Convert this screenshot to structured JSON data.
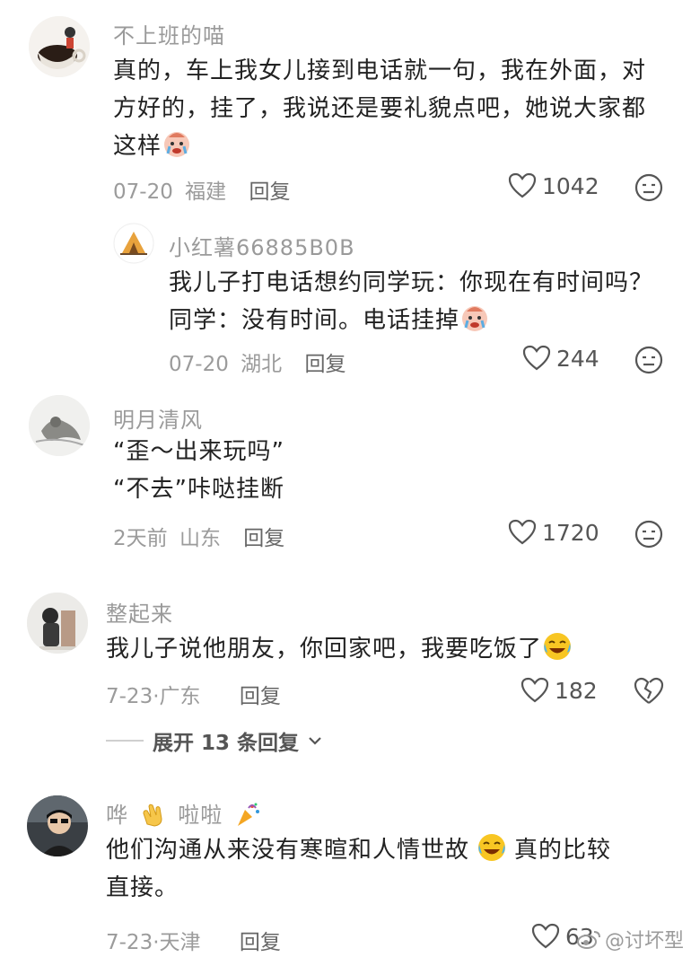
{
  "comments": [
    {
      "name": "不上班的喵",
      "text": "真的，车上我女儿接到电话就一句，我在外面，对方好的，挂了，我说还是要礼貌点吧，她说大家都这样",
      "date": "07-20",
      "location": "福建",
      "reply": "回复",
      "likes": "1042"
    },
    {
      "name": "小红薯66885B0B",
      "line1": "我儿子打电话想约同学玩：你现在有时间吗？",
      "line2": "同学：没有时间。电话挂掉",
      "date": "07-20",
      "location": "湖北",
      "reply": "回复",
      "likes": "244"
    },
    {
      "name": "明月清风",
      "line1": "“歪～出来玩吗”",
      "line2": "“不去”咔哒挂断",
      "date": "2天前",
      "location": "山东",
      "reply": "回复",
      "likes": "1720"
    },
    {
      "name": "整起来",
      "text": "我儿子说他朋友，你回家吧，我要吃饭了",
      "date": "7-23·",
      "location": "广东",
      "reply": "回复",
      "likes": "182"
    },
    {
      "name_part1": "哗",
      "name_part2": "啦啦",
      "line1": "他们沟通从来没有寒暄和人情世故",
      "line1b": "真的比较",
      "line2": "直接。",
      "date": "7-23·",
      "location": "天津",
      "reply": "回复",
      "likes": "63"
    }
  ],
  "expand": {
    "label": "展开 13 条回复"
  },
  "watermark": {
    "text": "@讨坏型"
  },
  "colors": {
    "meta": "#9b9b9b",
    "text": "#222222",
    "name": "#9a9a9a"
  }
}
